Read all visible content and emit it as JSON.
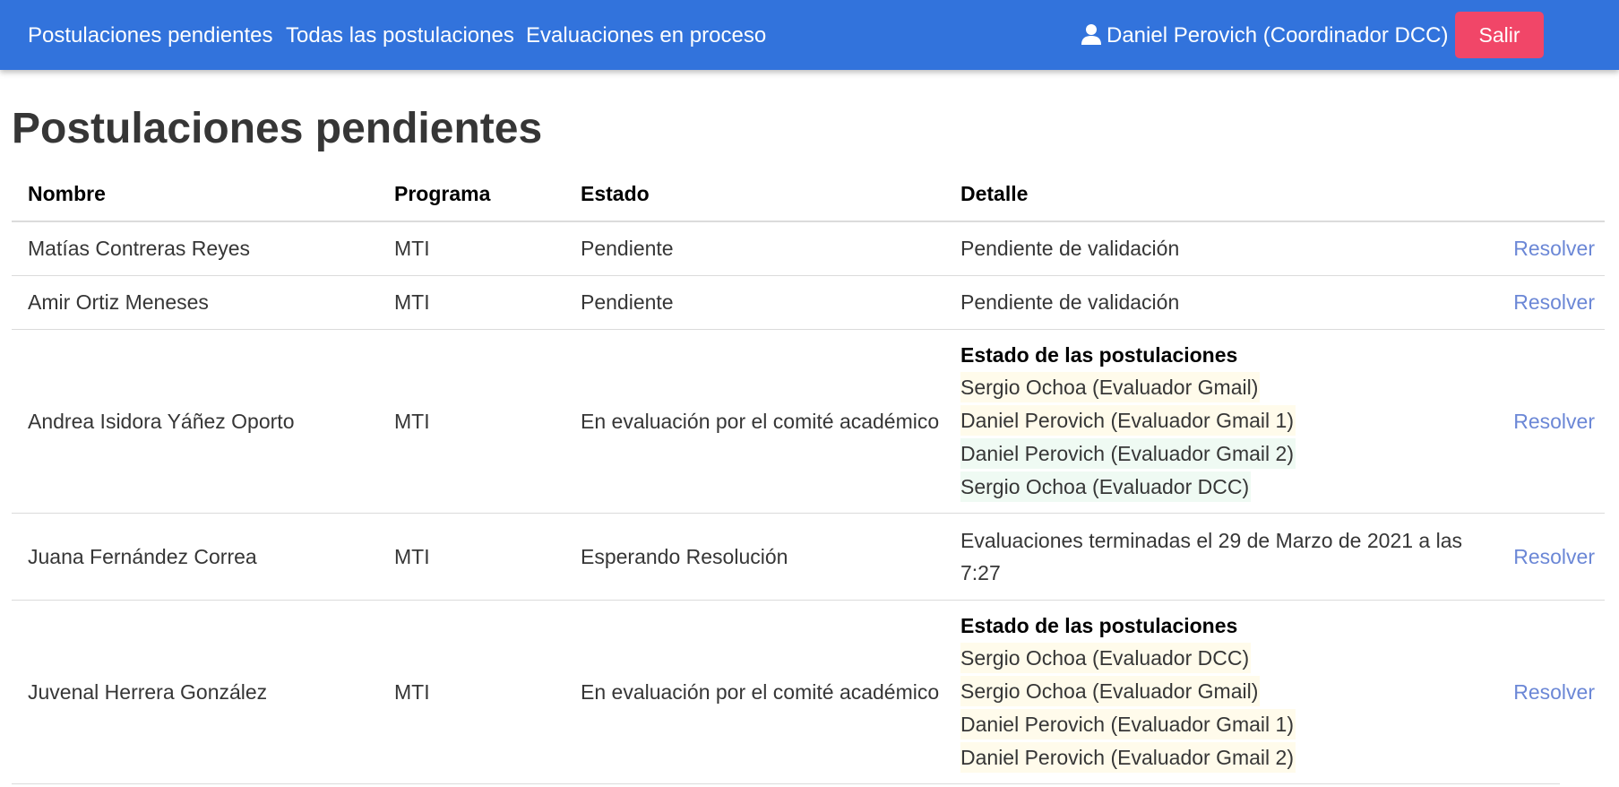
{
  "navbar": {
    "items": [
      {
        "label": "Postulaciones pendientes"
      },
      {
        "label": "Todas las postulaciones"
      },
      {
        "label": "Evaluaciones en proceso"
      }
    ],
    "user_label": "Daniel Perovich (Coordinador DCC)",
    "logout_label": "Salir",
    "colors": {
      "background": "#3273dc",
      "logout": "#f14668"
    }
  },
  "page": {
    "title": "Postulaciones pendientes"
  },
  "table": {
    "headers": [
      "Nombre",
      "Programa",
      "Estado",
      "Detalle"
    ],
    "action_label": "Resolver",
    "rows": [
      {
        "name": "Matías Contreras Reyes",
        "program": "MTI",
        "state": "Pendiente",
        "detail": "Pendiente de validación"
      },
      {
        "name": "Amir Ortiz Meneses",
        "program": "MTI",
        "state": "Pendiente",
        "detail": "Pendiente de validación"
      },
      {
        "name": "Andrea Isidora Yáñez Oporto",
        "program": "MTI",
        "state": "En evaluación por el comité académico",
        "detail_title": "Estado de las postulaciones",
        "evaluators": [
          {
            "label": "Sergio Ochoa (Evaluador Gmail)",
            "status_color": "#fffbeb"
          },
          {
            "label": "Daniel Perovich (Evaluador Gmail 1)",
            "status_color": "#fffbeb"
          },
          {
            "label": "Daniel Perovich (Evaluador Gmail 2)",
            "status_color": "#effaf3"
          },
          {
            "label": "Sergio Ochoa (Evaluador DCC)",
            "status_color": "#effaf3"
          }
        ]
      },
      {
        "name": "Juana Fernández Correa",
        "program": "MTI",
        "state": "Esperando Resolución",
        "detail": "Evaluaciones terminadas el 29 de Marzo de 2021 a las 7:27"
      },
      {
        "name": "Juvenal Herrera González",
        "program": "MTI",
        "state": "En evaluación por el comité académico",
        "detail_title": "Estado de las postulaciones",
        "evaluators": [
          {
            "label": "Sergio Ochoa (Evaluador DCC)",
            "status_color": "#fffbeb"
          },
          {
            "label": "Sergio Ochoa (Evaluador Gmail)",
            "status_color": "#fffbeb"
          },
          {
            "label": "Daniel Perovich (Evaluador Gmail 1)",
            "status_color": "#fffbeb"
          },
          {
            "label": "Daniel Perovich (Evaluador Gmail 2)",
            "status_color": "#fffbeb"
          }
        ]
      }
    ]
  }
}
